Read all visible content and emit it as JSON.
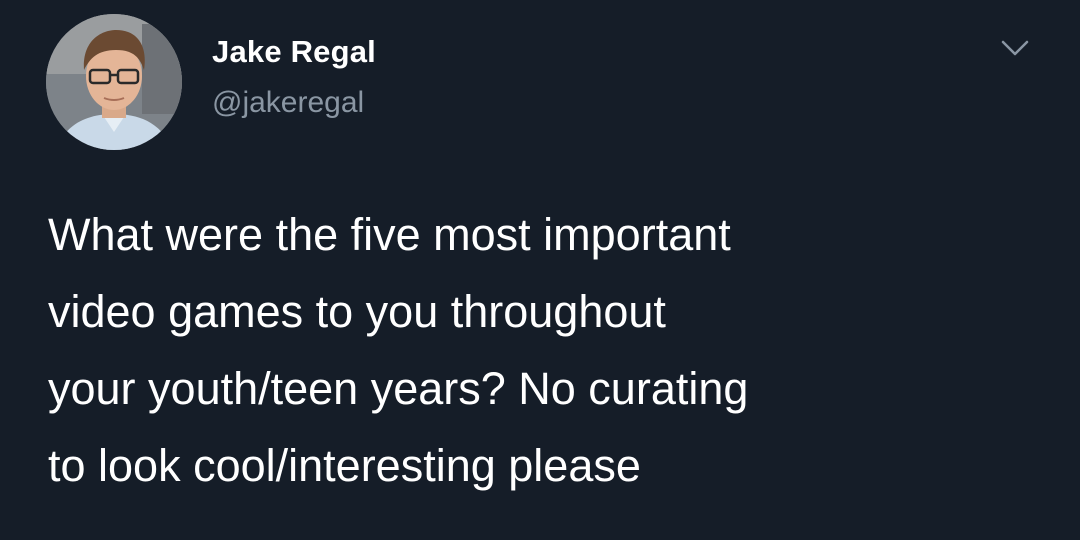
{
  "tweet": {
    "author": {
      "name": "Jake Regal",
      "handle": "@jakeregal",
      "avatar_icon": "avatar-photo"
    },
    "menu_icon": "chevron-down-icon",
    "text_lines": [
      "What were the five most important",
      "video games to you throughout",
      "your youth/teen years? No curating",
      "to look cool/interesting please"
    ]
  },
  "colors": {
    "background": "#151d28",
    "text": "#ffffff",
    "handle": "#8a96a3"
  }
}
